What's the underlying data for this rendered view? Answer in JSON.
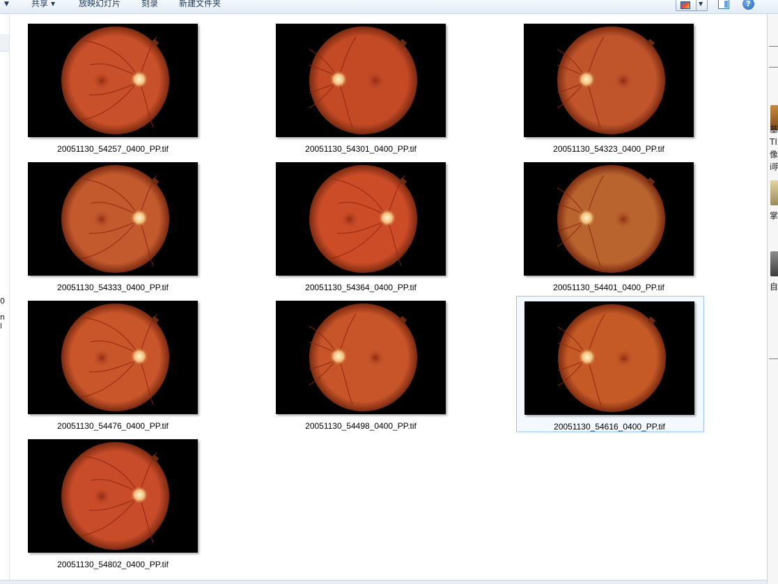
{
  "toolbar": {
    "share_label": "共享",
    "slideshow_label": "放映幻灯片",
    "burn_label": "刻录",
    "new_folder_label": "新建文件夹",
    "help_glyph": "?"
  },
  "nav_fragments": [
    "0",
    "n l"
  ],
  "right_fragments": [
    "基",
    "TI",
    "像",
    "i明",
    "掌",
    "自眼"
  ],
  "files": [
    {
      "name": "20051130_54257_0400_PP.tif",
      "optic_disc": "right",
      "tone": "#c8502a",
      "selected": false
    },
    {
      "name": "20051130_54301_0400_PP.tif",
      "optic_disc": "left",
      "tone": "#c44a26",
      "selected": false
    },
    {
      "name": "20051130_54323_0400_PP.tif",
      "optic_disc": "left",
      "tone": "#c0552c",
      "selected": false
    },
    {
      "name": "20051130_54333_0400_PP.tif",
      "optic_disc": "right",
      "tone": "#c35a2e",
      "selected": false
    },
    {
      "name": "20051130_54364_0400_PP.tif",
      "optic_disc": "right",
      "tone": "#cc4c28",
      "selected": false
    },
    {
      "name": "20051130_54401_0400_PP.tif",
      "optic_disc": "left",
      "tone": "#b9642f",
      "selected": false
    },
    {
      "name": "20051130_54476_0400_PP.tif",
      "optic_disc": "right",
      "tone": "#c9562b",
      "selected": false
    },
    {
      "name": "20051130_54498_0400_PP.tif",
      "optic_disc": "left",
      "tone": "#c8552a",
      "selected": false
    },
    {
      "name": "20051130_54616_0400_PP.tif",
      "optic_disc": "left",
      "tone": "#c55a26",
      "selected": true
    },
    {
      "name": "20051130_54802_0400_PP.tif",
      "optic_disc": "right",
      "tone": "#c84c2a",
      "selected": false
    }
  ]
}
